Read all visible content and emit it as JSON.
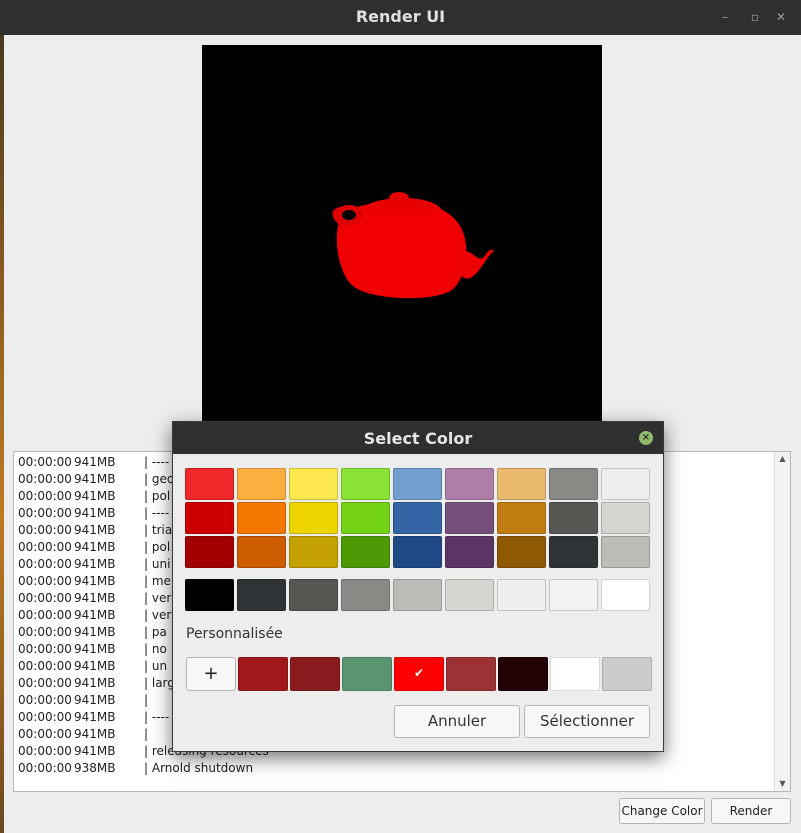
{
  "window": {
    "title": "Render UI"
  },
  "buttons": {
    "change_color": "Change Color",
    "render": "Render"
  },
  "log": {
    "rows": [
      {
        "time": "00:00:00",
        "mem": "941MB",
        "msg": "| ----"
      },
      {
        "time": "00:00:00",
        "mem": "941MB",
        "msg": "| geo"
      },
      {
        "time": "00:00:00",
        "mem": "941MB",
        "msg": "|  pol"
      },
      {
        "time": "00:00:00",
        "mem": "941MB",
        "msg": "| ----"
      },
      {
        "time": "00:00:00",
        "mem": "941MB",
        "msg": "| trian"
      },
      {
        "time": "00:00:00",
        "mem": "941MB",
        "msg": "|  pol"
      },
      {
        "time": "00:00:00",
        "mem": "941MB",
        "msg": "|  uni"
      },
      {
        "time": "00:00:00",
        "mem": "941MB",
        "msg": "| me"
      },
      {
        "time": "00:00:00",
        "mem": "941MB",
        "msg": "|   ver"
      },
      {
        "time": "00:00:00",
        "mem": "941MB",
        "msg": "|   ver"
      },
      {
        "time": "00:00:00",
        "mem": "941MB",
        "msg": "|   pa"
      },
      {
        "time": "00:00:00",
        "mem": "941MB",
        "msg": "|   no"
      },
      {
        "time": "00:00:00",
        "mem": "941MB",
        "msg": "|   un"
      },
      {
        "time": "00:00:00",
        "mem": "941MB",
        "msg": "|  larg"
      },
      {
        "time": "00:00:00",
        "mem": "941MB",
        "msg": "|"
      },
      {
        "time": "00:00:00",
        "mem": "941MB",
        "msg": "| ----"
      },
      {
        "time": "00:00:00",
        "mem": "941MB",
        "msg": "|"
      },
      {
        "time": "00:00:00",
        "mem": "941MB",
        "msg": "| releasing resources"
      },
      {
        "time": "00:00:00",
        "mem": "938MB",
        "msg": "| Arnold shutdown"
      }
    ]
  },
  "dialog": {
    "title": "Select Color",
    "custom_label": "Personnalisée",
    "add_label": "+",
    "cancel_label": "Annuler",
    "select_label": "Sélectionner",
    "selected_custom_index": 4,
    "palette": [
      [
        "#ef2929",
        "#fcaf3e",
        "#fce94f",
        "#8ae234",
        "#729fcf",
        "#ad7fa8",
        "#e9b96e",
        "#888a85",
        "#eeeeec"
      ],
      [
        "#cc0000",
        "#f57900",
        "#edd400",
        "#73d216",
        "#3465a4",
        "#75507b",
        "#c17d11",
        "#555753",
        "#d3d7cf"
      ],
      [
        "#a40000",
        "#ce5c00",
        "#c4a000",
        "#4e9a06",
        "#204a87",
        "#5c3566",
        "#8f5902",
        "#2e3436",
        "#babdb6"
      ]
    ],
    "grays": [
      "#000000",
      "#2e3436",
      "#555753",
      "#888a85",
      "#babdb6",
      "#d3d7cf",
      "#eeeeec",
      "#f3f3f3",
      "#ffffff"
    ],
    "custom": [
      "#a0181b",
      "#8a1c1f",
      "#5a9470",
      "#ff0000",
      "#9c3234",
      "#220405",
      "#ffffff",
      "#cccccc"
    ]
  }
}
